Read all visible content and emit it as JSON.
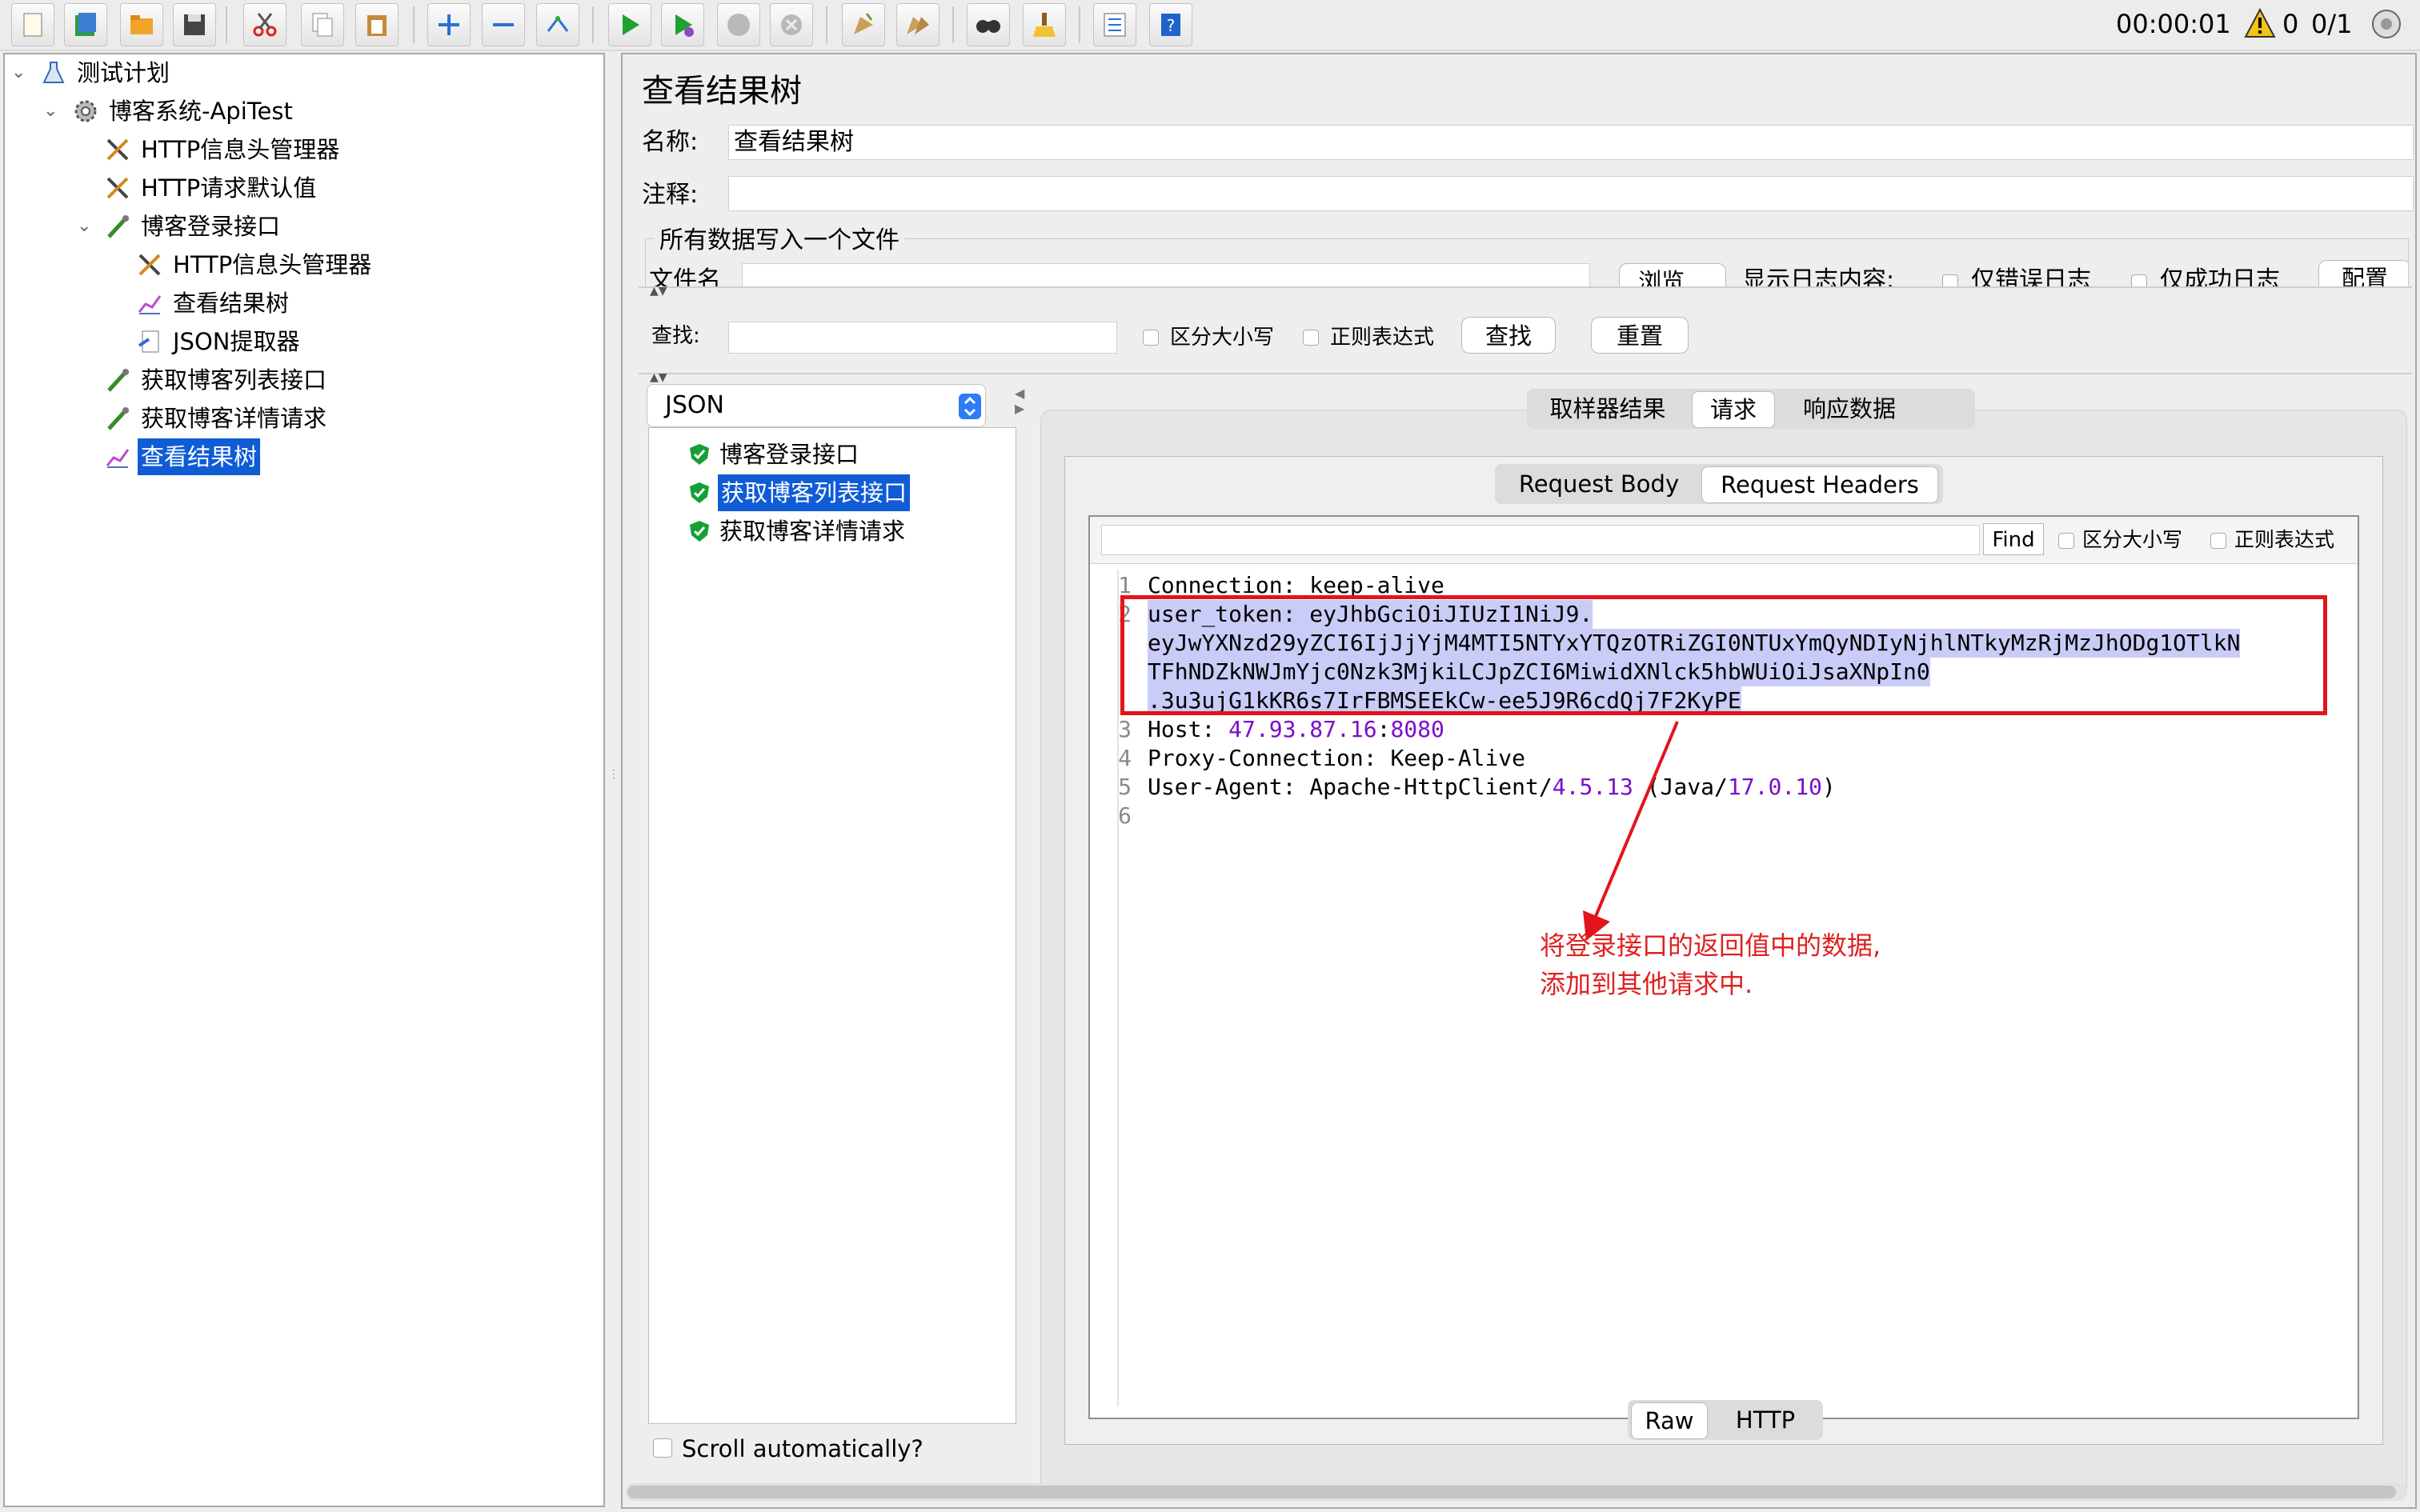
{
  "toolbar": {
    "buttons": [
      "new-icon",
      "templates-icon",
      "open-icon",
      "save-icon",
      "cut-icon",
      "copy-icon",
      "paste-icon",
      "expand-icon",
      "collapse-icon",
      "toggle-icon",
      "start-icon",
      "start-no-timers-icon",
      "stop-icon",
      "shutdown-icon",
      "clear-icon",
      "clear-all-icon",
      "search-icon",
      "reset-search-icon",
      "function-helper-icon",
      "help-icon"
    ],
    "timer": "00:00:01",
    "warning_count": "0",
    "threads": "0/1"
  },
  "tree": {
    "items": [
      {
        "label": "测试计划",
        "icon": "test-plan-icon"
      },
      {
        "label": "博客系统-ApiTest",
        "icon": "gear-icon"
      },
      {
        "label": "HTTP信息头管理器",
        "icon": "tools-icon"
      },
      {
        "label": "HTTP请求默认值",
        "icon": "tools-icon"
      },
      {
        "label": "博客登录接口",
        "icon": "sampler-icon"
      },
      {
        "label": "HTTP信息头管理器",
        "icon": "tools-icon"
      },
      {
        "label": "查看结果树",
        "icon": "chart-icon"
      },
      {
        "label": "JSON提取器",
        "icon": "extractor-icon"
      },
      {
        "label": "获取博客列表接口",
        "icon": "sampler-icon"
      },
      {
        "label": "获取博客详情请求",
        "icon": "sampler-icon"
      },
      {
        "label": "查看结果树",
        "icon": "chart-icon",
        "selected": true
      }
    ]
  },
  "panel": {
    "title": "查看结果树",
    "name_label": "名称:",
    "name_value": "查看结果树",
    "comment_label": "注释:",
    "comment_value": "",
    "file_group_label": "所有数据写入一个文件",
    "filename_label": "文件名",
    "browse_label": "浏览...",
    "log_display_label": "显示日志内容:",
    "errors_only_label": "仅错误日志",
    "success_only_label": "仅成功日志",
    "config_label": "配置"
  },
  "search_bar": {
    "label": "查找:",
    "value": "",
    "case_label": "区分大小写",
    "regex_label": "正则表达式",
    "find_button": "查找",
    "reset_button": "重置"
  },
  "results": {
    "renderer": "JSON",
    "samples": [
      "博客登录接口",
      "获取博客列表接口",
      "获取博客详情请求"
    ],
    "selected_index": 1,
    "scroll_label": "Scroll automatically?"
  },
  "detail": {
    "tabs": [
      "取样器结果",
      "请求",
      "响应数据"
    ],
    "active_tab": "请求",
    "sub_tabs": [
      "Request Body",
      "Request Headers"
    ],
    "active_sub_tab": "Request Headers",
    "find_value": "",
    "find_button": "Find",
    "case_label": "区分大小写",
    "regex_label": "正则表达式",
    "bottom_tabs": [
      "Raw",
      "HTTP"
    ],
    "active_bottom_tab": "Raw",
    "lines": {
      "l1_num": "1",
      "l1_key": "Connection",
      "l1_sep": ": ",
      "l1_val": "keep-alive",
      "l2_num": "2",
      "l2_key": "user_token",
      "l2_sep": ": ",
      "l2_val": "eyJhbGciOiJIUzI1NiJ9.",
      "l2_c1": "eyJwYXNzd29yZCI6IjJjYjM4MTI5NTYxYTQzOTRiZGI0NTUxYmQyNDIyNjhlNTkyMzRjMzJhODg1OTlkN",
      "l2_c2": "TFhNDZkNWJmYjc0Nzk3MjkiLCJpZCI6MiwidXNlck5hbWUiOiJsaXNpIn0",
      "l2_c3": ".3u3ujG1kKR6s7IrFBMSEEkCw-ee5J9R6cdQj7F2KyPE",
      "l3_num": "3",
      "l3_key": "Host",
      "l3_sep": ": ",
      "l3_ip": "47.93.87.16",
      "l3_colon": ":",
      "l3_port": "8080",
      "l4_num": "4",
      "l4_key": "Proxy-Connection",
      "l4_sep": ": ",
      "l4_val": "Keep-Alive",
      "l5_num": "5",
      "l5_key": "User-Agent",
      "l5_sep": ": ",
      "l5_a": "Apache-HttpClient/",
      "l5_v1": "4.5.13",
      "l5_b": " (Java/",
      "l5_v2": "17.0.10",
      "l5_c": ")",
      "l6_num": "6"
    }
  },
  "annotation": {
    "line1": "将登录接口的返回值中的数据,",
    "line2": "添加到其他请求中.",
    "color": "#e02020"
  }
}
